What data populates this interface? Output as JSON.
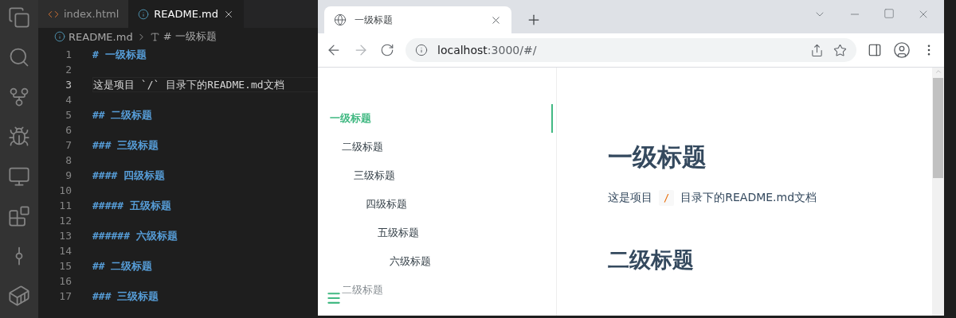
{
  "editor": {
    "tabs": [
      {
        "label": "index.html",
        "kind": "html",
        "selected": false
      },
      {
        "label": "README.md",
        "kind": "markdown",
        "selected": true
      }
    ],
    "breadcrumb": {
      "file": "README.md",
      "symbol": "# 一级标题"
    },
    "lines": [
      {
        "number": "1",
        "kind": "heading",
        "text": "# 一级标题",
        "current": false
      },
      {
        "number": "2",
        "kind": "blank",
        "current": false
      },
      {
        "number": "3",
        "kind": "text",
        "text": "这是项目 `/` 目录下的README.md文档",
        "current": true
      },
      {
        "number": "4",
        "kind": "blank",
        "current": false
      },
      {
        "number": "5",
        "kind": "heading",
        "text": "## 二级标题",
        "current": false
      },
      {
        "number": "6",
        "kind": "blank",
        "current": false
      },
      {
        "number": "7",
        "kind": "heading",
        "text": "### 三级标题",
        "current": false
      },
      {
        "number": "8",
        "kind": "blank",
        "current": false
      },
      {
        "number": "9",
        "kind": "heading",
        "text": "#### 四级标题",
        "current": false
      },
      {
        "number": "10",
        "kind": "blank",
        "current": false
      },
      {
        "number": "11",
        "kind": "heading",
        "text": "##### 五级标题",
        "current": false
      },
      {
        "number": "12",
        "kind": "blank",
        "current": false
      },
      {
        "number": "13",
        "kind": "heading",
        "text": "###### 六级标题",
        "current": false
      },
      {
        "number": "14",
        "kind": "blank",
        "current": false
      },
      {
        "number": "15",
        "kind": "heading",
        "text": "## 二级标题",
        "current": false
      },
      {
        "number": "16",
        "kind": "blank",
        "current": false
      },
      {
        "number": "17",
        "kind": "heading",
        "text": "### 三级标题",
        "current": false
      }
    ]
  },
  "browser": {
    "tab": {
      "title": "一级标题"
    },
    "address": {
      "host": "localhost",
      "rest": ":3000/#/"
    },
    "sidebar": {
      "items": [
        {
          "label": "一级标题",
          "selected": true,
          "children": [
            {
              "label": "二级标题",
              "selected": false,
              "children": [
                {
                  "label": "三级标题",
                  "selected": false,
                  "children": [
                    {
                      "label": "四级标题",
                      "selected": false,
                      "children": [
                        {
                          "label": "五级标题",
                          "selected": false,
                          "children": [
                            {
                              "label": "六级标题",
                              "selected": false
                            }
                          ]
                        }
                      ]
                    }
                  ]
                }
              ]
            },
            {
              "label": "二级标题",
              "selected": false
            }
          ]
        }
      ]
    },
    "content": {
      "h1": "一级标题",
      "paragraph": [
        {
          "kind": "text",
          "text": "这是项目"
        },
        {
          "kind": "code",
          "text": "/"
        },
        {
          "kind": "text",
          "text": "目录下的README.md文档"
        }
      ],
      "h2": "二级标题"
    }
  }
}
